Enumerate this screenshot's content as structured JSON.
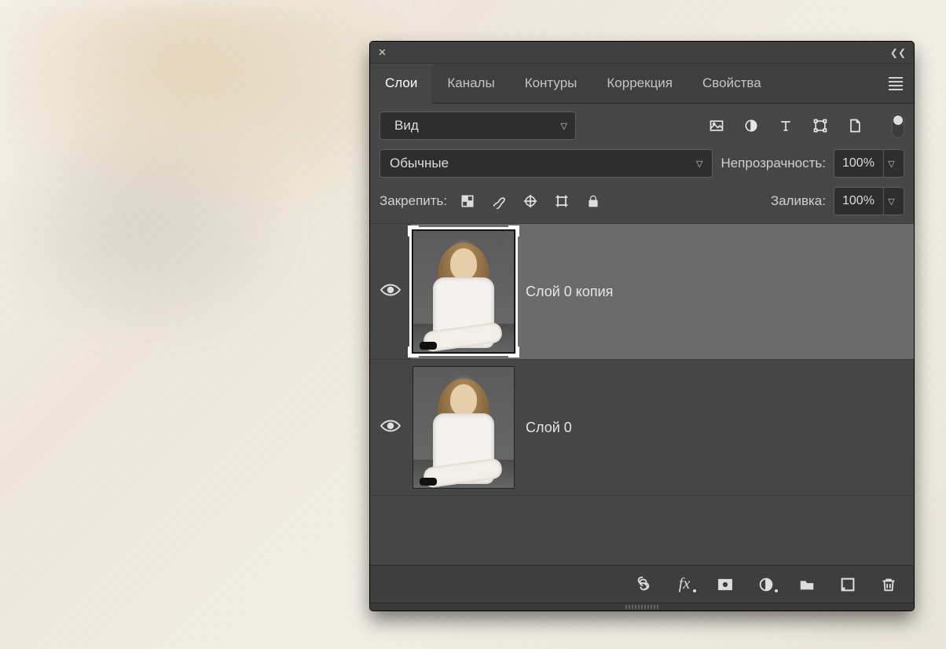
{
  "tabs": {
    "layers": "Слои",
    "channels": "Каналы",
    "paths": "Контуры",
    "adjustments": "Коррекция",
    "properties": "Свойства"
  },
  "search": {
    "label": "Вид"
  },
  "blend": {
    "mode": "Обычные",
    "opacity_label": "Непрозрачность:",
    "opacity_value": "100%"
  },
  "lock": {
    "label": "Закрепить:",
    "fill_label": "Заливка:",
    "fill_value": "100%"
  },
  "layers": [
    {
      "name": "Слой 0 копия",
      "selected": true
    },
    {
      "name": "Слой 0",
      "selected": false
    }
  ]
}
